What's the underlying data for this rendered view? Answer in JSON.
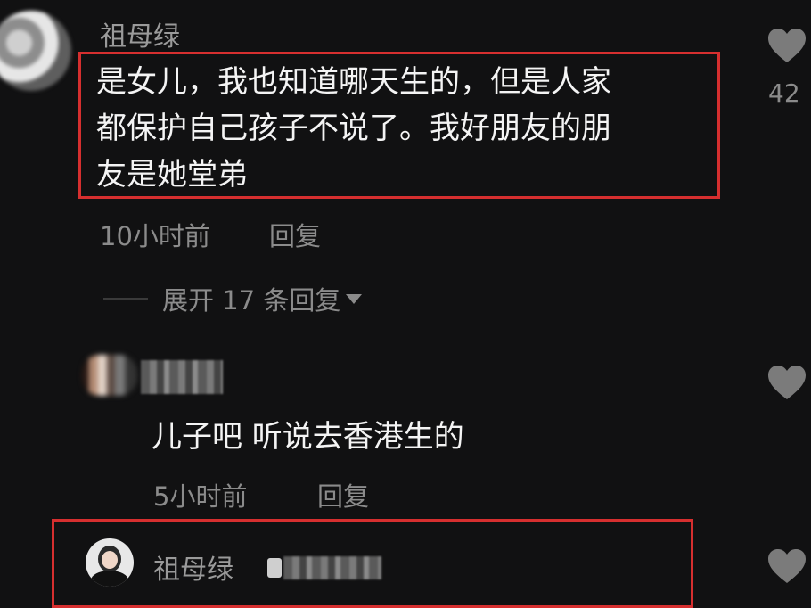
{
  "comments": [
    {
      "username": "祖母绿",
      "text_lines": [
        "是女儿，我也知道哪天生的，但是人家",
        "都保护自己孩子不说了。我好朋友的朋",
        "友是她堂弟"
      ],
      "time": "10小时前",
      "reply_label": "回复",
      "likes": "42",
      "expand_label": "展开 17 条回复"
    },
    {
      "text": "儿子吧 听说去香港生的",
      "time": "5小时前",
      "reply_label": "回复"
    },
    {
      "username": "祖母绿"
    }
  ],
  "colors": {
    "background": "#111112",
    "highlight_box": "#d62f2f",
    "meta_text": "#8b8b8b"
  },
  "icons": [
    "heart-icon",
    "dropdown-triangle-icon",
    "author-badge-icon"
  ]
}
